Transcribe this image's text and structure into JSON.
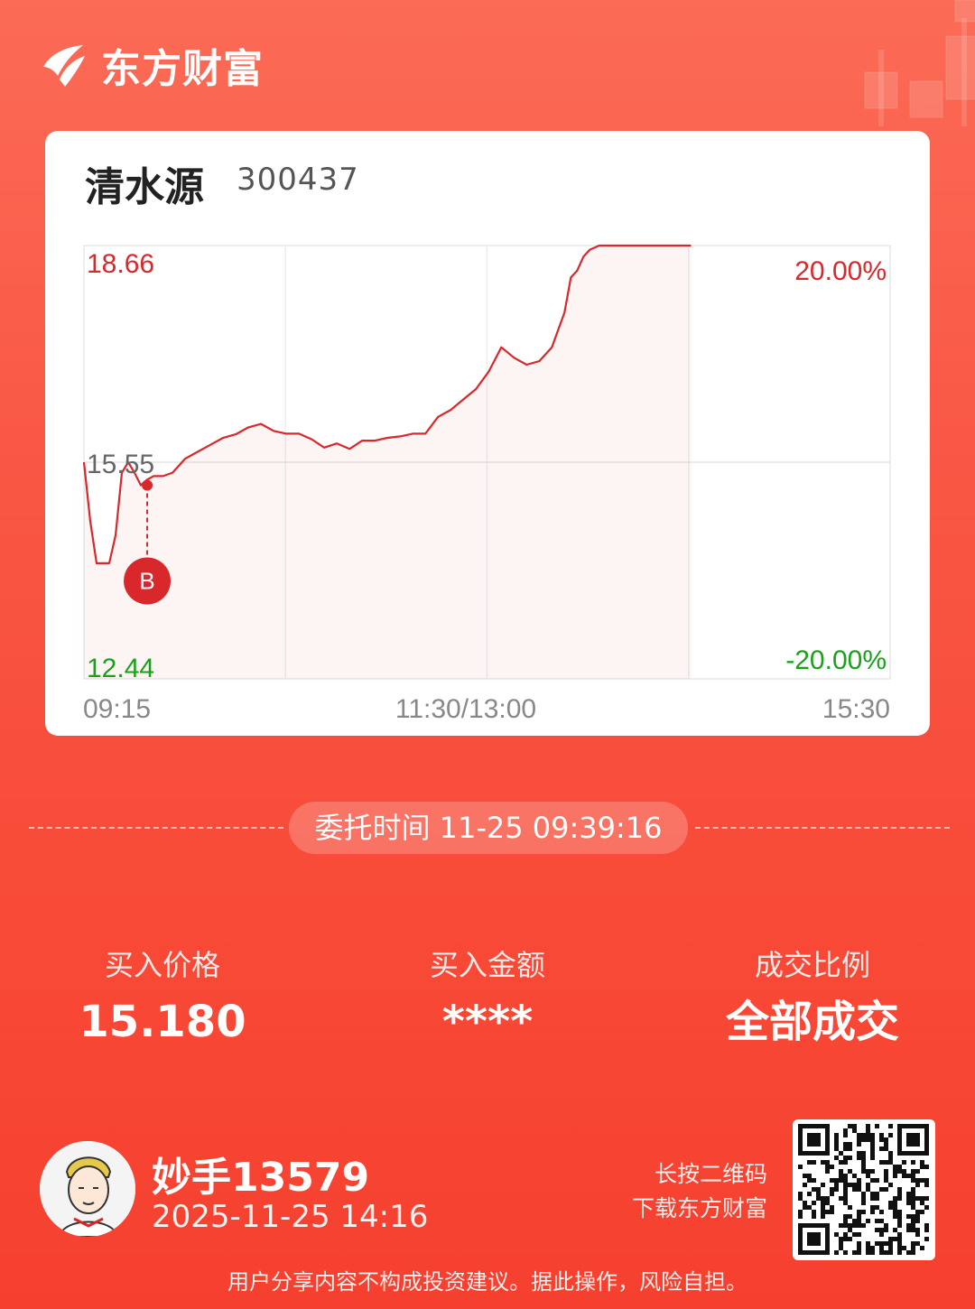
{
  "brand": {
    "name": "东方财富",
    "logo_icon": "eastmoney-logo-icon"
  },
  "stock": {
    "name": "清水源",
    "code": "300437"
  },
  "chart_data": {
    "type": "line",
    "price_labels": {
      "high": "18.66",
      "mid": "15.55",
      "low": "12.44"
    },
    "pct_labels": {
      "high": "20.00%",
      "low": "-20.00%"
    },
    "time_labels": [
      "09:15",
      "11:30/13:00",
      "15:30"
    ],
    "ylim": [
      12.44,
      18.66
    ],
    "x_minutes_range": [
      0,
      255
    ],
    "series": [
      {
        "x": [
          0,
          2,
          4,
          6,
          8,
          10,
          12,
          14,
          16,
          18,
          20,
          22,
          25,
          28,
          32,
          36,
          40,
          44,
          48,
          52,
          56,
          60,
          64,
          68,
          72,
          76,
          80,
          84,
          88,
          92,
          96,
          100,
          104,
          108,
          112,
          116,
          120,
          124,
          128,
          132,
          136,
          140,
          144,
          148,
          152,
          154,
          156,
          158,
          160,
          163,
          166,
          169,
          172,
          175,
          177,
          180,
          184,
          188,
          192
        ],
        "y": [
          15.55,
          14.7,
          14.1,
          14.1,
          14.1,
          14.5,
          15.4,
          15.55,
          15.4,
          15.22,
          15.3,
          15.35,
          15.35,
          15.4,
          15.6,
          15.7,
          15.8,
          15.9,
          15.95,
          16.05,
          16.1,
          16.0,
          15.96,
          15.96,
          15.88,
          15.76,
          15.82,
          15.74,
          15.86,
          15.86,
          15.9,
          15.92,
          15.96,
          15.96,
          16.2,
          16.3,
          16.45,
          16.6,
          16.85,
          17.2,
          17.05,
          16.95,
          17.0,
          17.2,
          17.7,
          18.2,
          18.3,
          18.5,
          18.6,
          18.66,
          18.66,
          18.66,
          18.66,
          18.66,
          18.66,
          18.66,
          18.66,
          18.66,
          18.66
        ]
      }
    ],
    "buy_marker": {
      "label": "B",
      "x": 20,
      "y": 15.22
    }
  },
  "order_time": "委托时间 11-25 09:39:16",
  "stats": [
    {
      "label": "买入价格",
      "value": "15.180"
    },
    {
      "label": "买入金额",
      "value": "****"
    },
    {
      "label": "成交比例",
      "value": "全部成交"
    }
  ],
  "user": {
    "name": "妙手13579",
    "time": "2025-11-25 14:16"
  },
  "qr": {
    "hint_line1": "长按二维码",
    "hint_line2": "下载东方财富"
  },
  "disclaimer": "用户分享内容不构成投资建议。据此操作，风险自担。",
  "colors": {
    "up": "#d8282b",
    "down": "#1aa11a",
    "bg": "#f95745"
  }
}
